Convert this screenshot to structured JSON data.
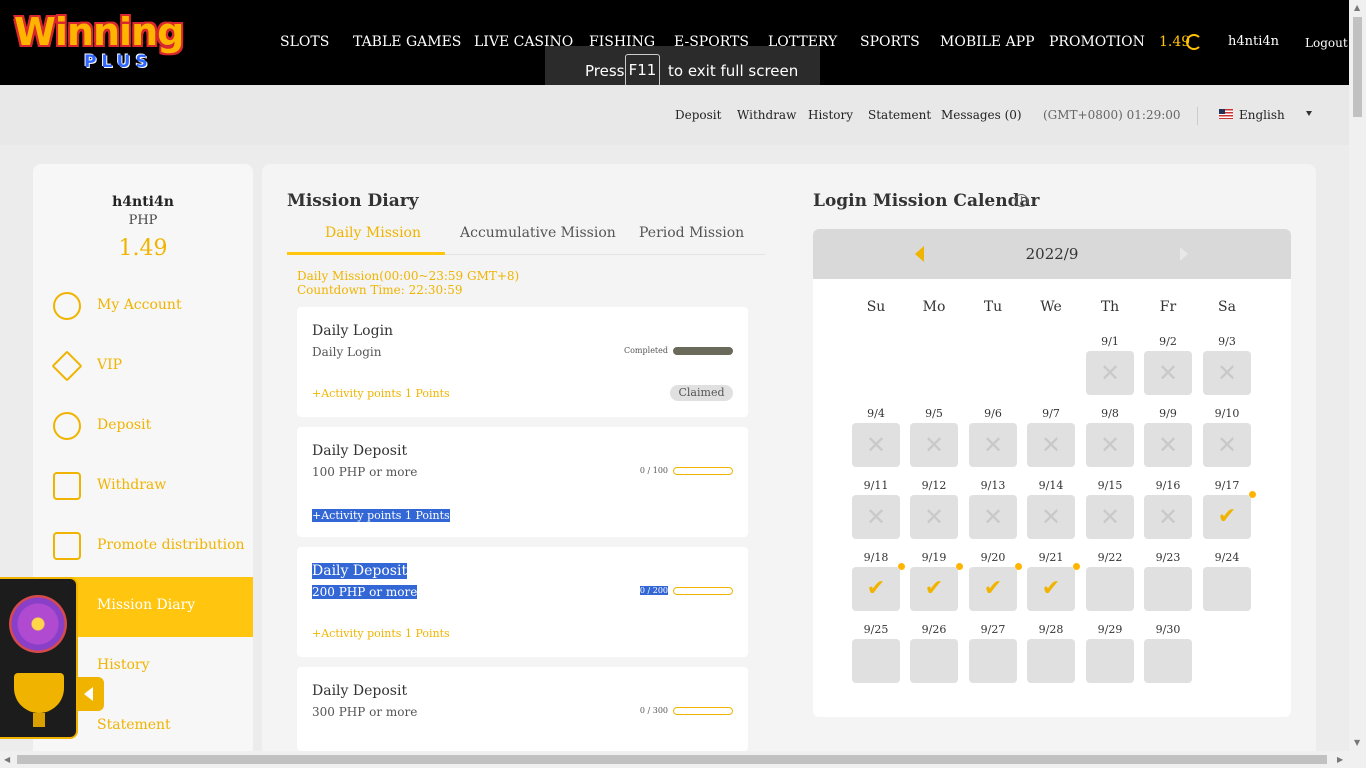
{
  "logo": {
    "line1": "Winning",
    "line2": "PLUS"
  },
  "nav": {
    "items": [
      "SLOTS",
      "TABLE GAMES",
      "LIVE CASINO",
      "FISHING",
      "E-SPORTS",
      "LOTTERY",
      "SPORTS",
      "MOBILE APP",
      "PROMOTION"
    ],
    "balance": "1.49",
    "username": "h4nti4n",
    "logout": "Logout"
  },
  "fullscreen": {
    "press": "Press",
    "key": "F11",
    "rest": "to exit full screen"
  },
  "subbar": {
    "links": [
      "Deposit",
      "Withdraw",
      "History",
      "Statement",
      "Messages (0)"
    ],
    "time": "(GMT+0800) 01:29:00",
    "language": "English"
  },
  "sidebar": {
    "username": "h4nti4n",
    "currency": "PHP",
    "balance": "1.49",
    "items": [
      "My Account",
      "VIP",
      "Deposit",
      "Withdraw",
      "Promote distribution",
      "Mission Diary",
      "History",
      "Statement"
    ]
  },
  "mission": {
    "title": "Mission Diary",
    "tabs": [
      "Daily Mission",
      "Accumulative Mission",
      "Period Mission"
    ],
    "note_line1": "Daily Mission(00:00~23:59 GMT+8)",
    "note_line2": "Countdown Time: 22:30:59",
    "cards": [
      {
        "title": "Daily Login",
        "sub": "Daily Login",
        "points": "+Activity points 1 Points",
        "progress": "Completed",
        "progress_fraction": 1,
        "status": "Claimed"
      },
      {
        "title": "Daily Deposit",
        "sub": "100 PHP or more",
        "points": "+Activity points 1 Points",
        "progress": "0 / 100",
        "progress_fraction": 0
      },
      {
        "title": "Daily Deposit",
        "sub": "200 PHP or more",
        "points": "+Activity points 1 Points",
        "progress": "0 / 200",
        "progress_fraction": 0
      },
      {
        "title": "Daily Deposit",
        "sub": "300 PHP or more",
        "points": "",
        "progress": "0 / 300",
        "progress_fraction": 0
      }
    ]
  },
  "calendar": {
    "title": "Login Mission Calendar",
    "info": "i",
    "month": "2022/9",
    "weekdays": [
      "Su",
      "Mo",
      "Tu",
      "We",
      "Th",
      "Fr",
      "Sa"
    ],
    "days": [
      {
        "label": "9/1",
        "state": "missed"
      },
      {
        "label": "9/2",
        "state": "missed"
      },
      {
        "label": "9/3",
        "state": "missed"
      },
      {
        "label": "9/4",
        "state": "missed"
      },
      {
        "label": "9/5",
        "state": "missed"
      },
      {
        "label": "9/6",
        "state": "missed"
      },
      {
        "label": "9/7",
        "state": "missed"
      },
      {
        "label": "9/8",
        "state": "missed"
      },
      {
        "label": "9/9",
        "state": "missed"
      },
      {
        "label": "9/10",
        "state": "missed"
      },
      {
        "label": "9/11",
        "state": "missed"
      },
      {
        "label": "9/12",
        "state": "missed"
      },
      {
        "label": "9/13",
        "state": "missed"
      },
      {
        "label": "9/14",
        "state": "missed"
      },
      {
        "label": "9/15",
        "state": "missed"
      },
      {
        "label": "9/16",
        "state": "missed"
      },
      {
        "label": "9/17",
        "state": "checked"
      },
      {
        "label": "9/18",
        "state": "checked"
      },
      {
        "label": "9/19",
        "state": "checked"
      },
      {
        "label": "9/20",
        "state": "checked"
      },
      {
        "label": "9/21",
        "state": "checked"
      },
      {
        "label": "9/22",
        "state": "empty"
      },
      {
        "label": "9/23",
        "state": "empty"
      },
      {
        "label": "9/24",
        "state": "empty"
      },
      {
        "label": "9/25",
        "state": "empty"
      },
      {
        "label": "9/26",
        "state": "empty"
      },
      {
        "label": "9/27",
        "state": "empty"
      },
      {
        "label": "9/28",
        "state": "empty"
      },
      {
        "label": "9/29",
        "state": "empty"
      },
      {
        "label": "9/30",
        "state": "empty"
      }
    ]
  },
  "colors": {
    "accent": "#ffc50f",
    "accent_text": "#f0b400",
    "topbar": "#000000"
  }
}
